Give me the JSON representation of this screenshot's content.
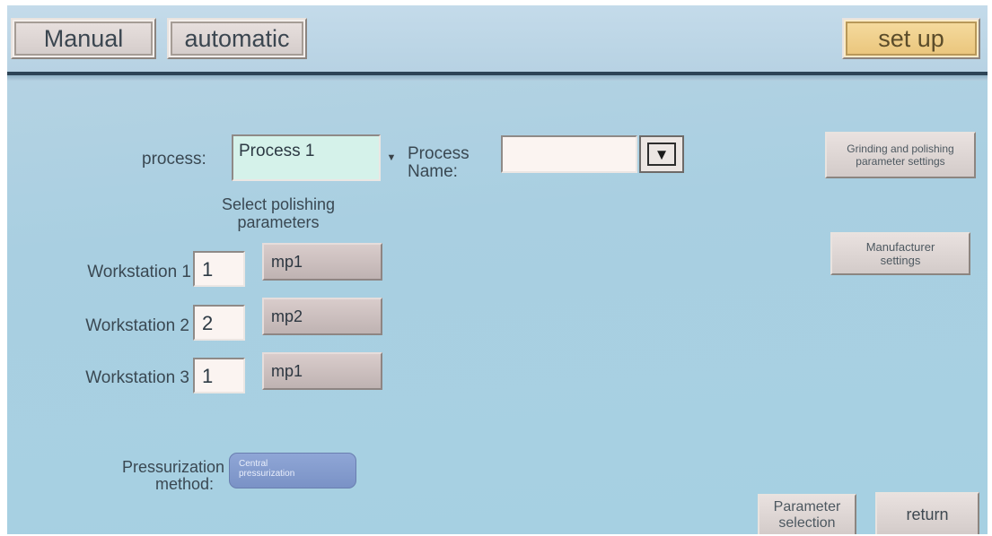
{
  "header": {
    "manual_label": "Manual",
    "automatic_label": "automatic",
    "setup_label": "set up"
  },
  "process": {
    "label": "process:",
    "value": "Process 1",
    "name_label_line1": "Process",
    "name_label_line2": "Name:",
    "name_value": ""
  },
  "polishing": {
    "heading_line1": "Select polishing",
    "heading_line2": "parameters",
    "workstations": [
      {
        "label": "Workstation 1",
        "number": "1",
        "param": "mp1"
      },
      {
        "label": "Workstation 2",
        "number": "2",
        "param": "mp2"
      },
      {
        "label": "Workstation 3",
        "number": "1",
        "param": "mp1"
      }
    ]
  },
  "pressurization": {
    "label_line1": "Pressurization",
    "label_line2": "method:",
    "button_line1": "Central",
    "button_line2": "pressurization"
  },
  "side": {
    "grinding_line1": "Grinding and polishing",
    "grinding_line2": "parameter settings",
    "manufacturer_line1": "Manufacturer",
    "manufacturer_line2": "settings"
  },
  "footer": {
    "param_line1": "Parameter",
    "param_line2": "selection",
    "return_label": "return"
  },
  "icons": {
    "process_dropdown": "caret-down-icon",
    "name_dropdown": "triangle-down-icon"
  },
  "colors": {
    "setup_accent": "#e9c47a",
    "process_field": "#d5f2ea",
    "pressurization_button": "#7a92c6",
    "screen_background": "#a9cfe1"
  }
}
